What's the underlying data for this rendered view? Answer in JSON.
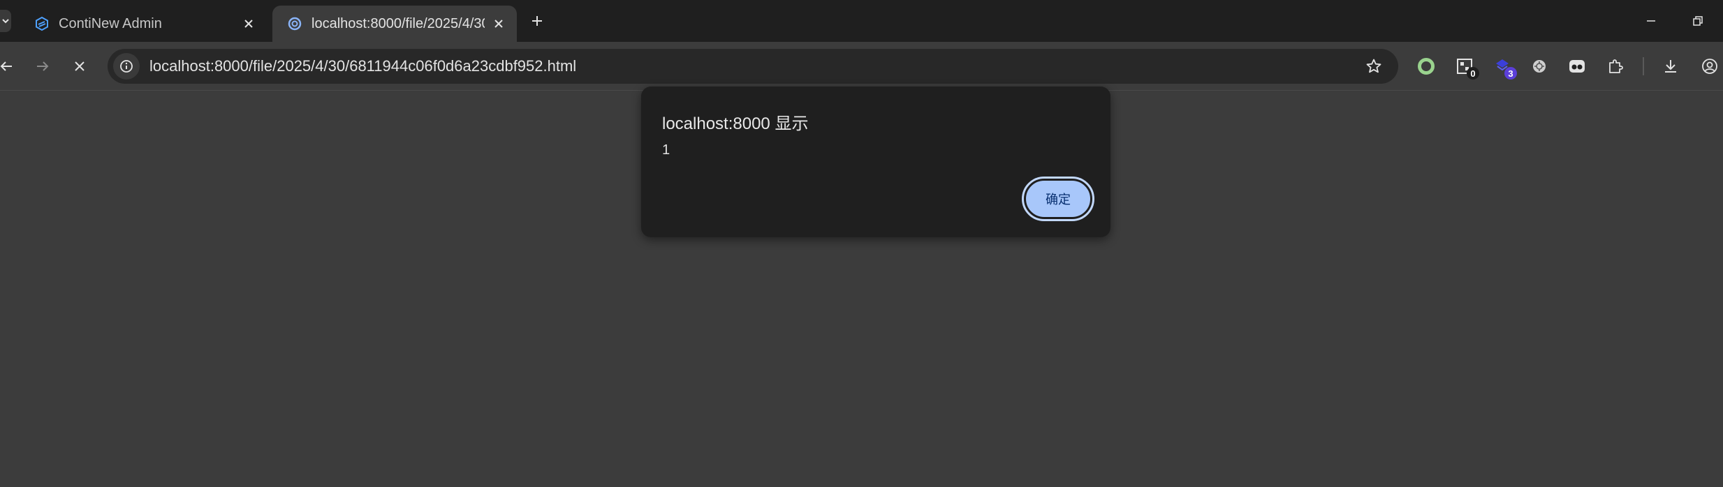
{
  "tabs": [
    {
      "title": "ContiNew Admin",
      "active": false,
      "favicon": "continew-logo-icon"
    },
    {
      "title": "localhost:8000/file/2025/4/30",
      "active": true,
      "favicon": "loading-spinner-icon"
    }
  ],
  "omnibox": {
    "url": "localhost:8000/file/2025/4/30/6811944c06f0d6a23cdbf952.html"
  },
  "extensions": [
    {
      "icon": "green-ring-extension-icon",
      "badge": ""
    },
    {
      "icon": "qr-extension-icon",
      "badge": "0"
    },
    {
      "icon": "blue-extension-icon",
      "badge": "3"
    },
    {
      "icon": "chatgpt-extension-icon",
      "badge": ""
    },
    {
      "icon": "eyes-extension-icon",
      "badge": ""
    }
  ],
  "dialog": {
    "title": "localhost:8000 显示",
    "message": "1",
    "ok_label": "确定"
  },
  "colors": {
    "dialog_bg": "#1f1f1f",
    "ok_button": "#a8c7fa",
    "page_bg": "#3c3c3c"
  }
}
